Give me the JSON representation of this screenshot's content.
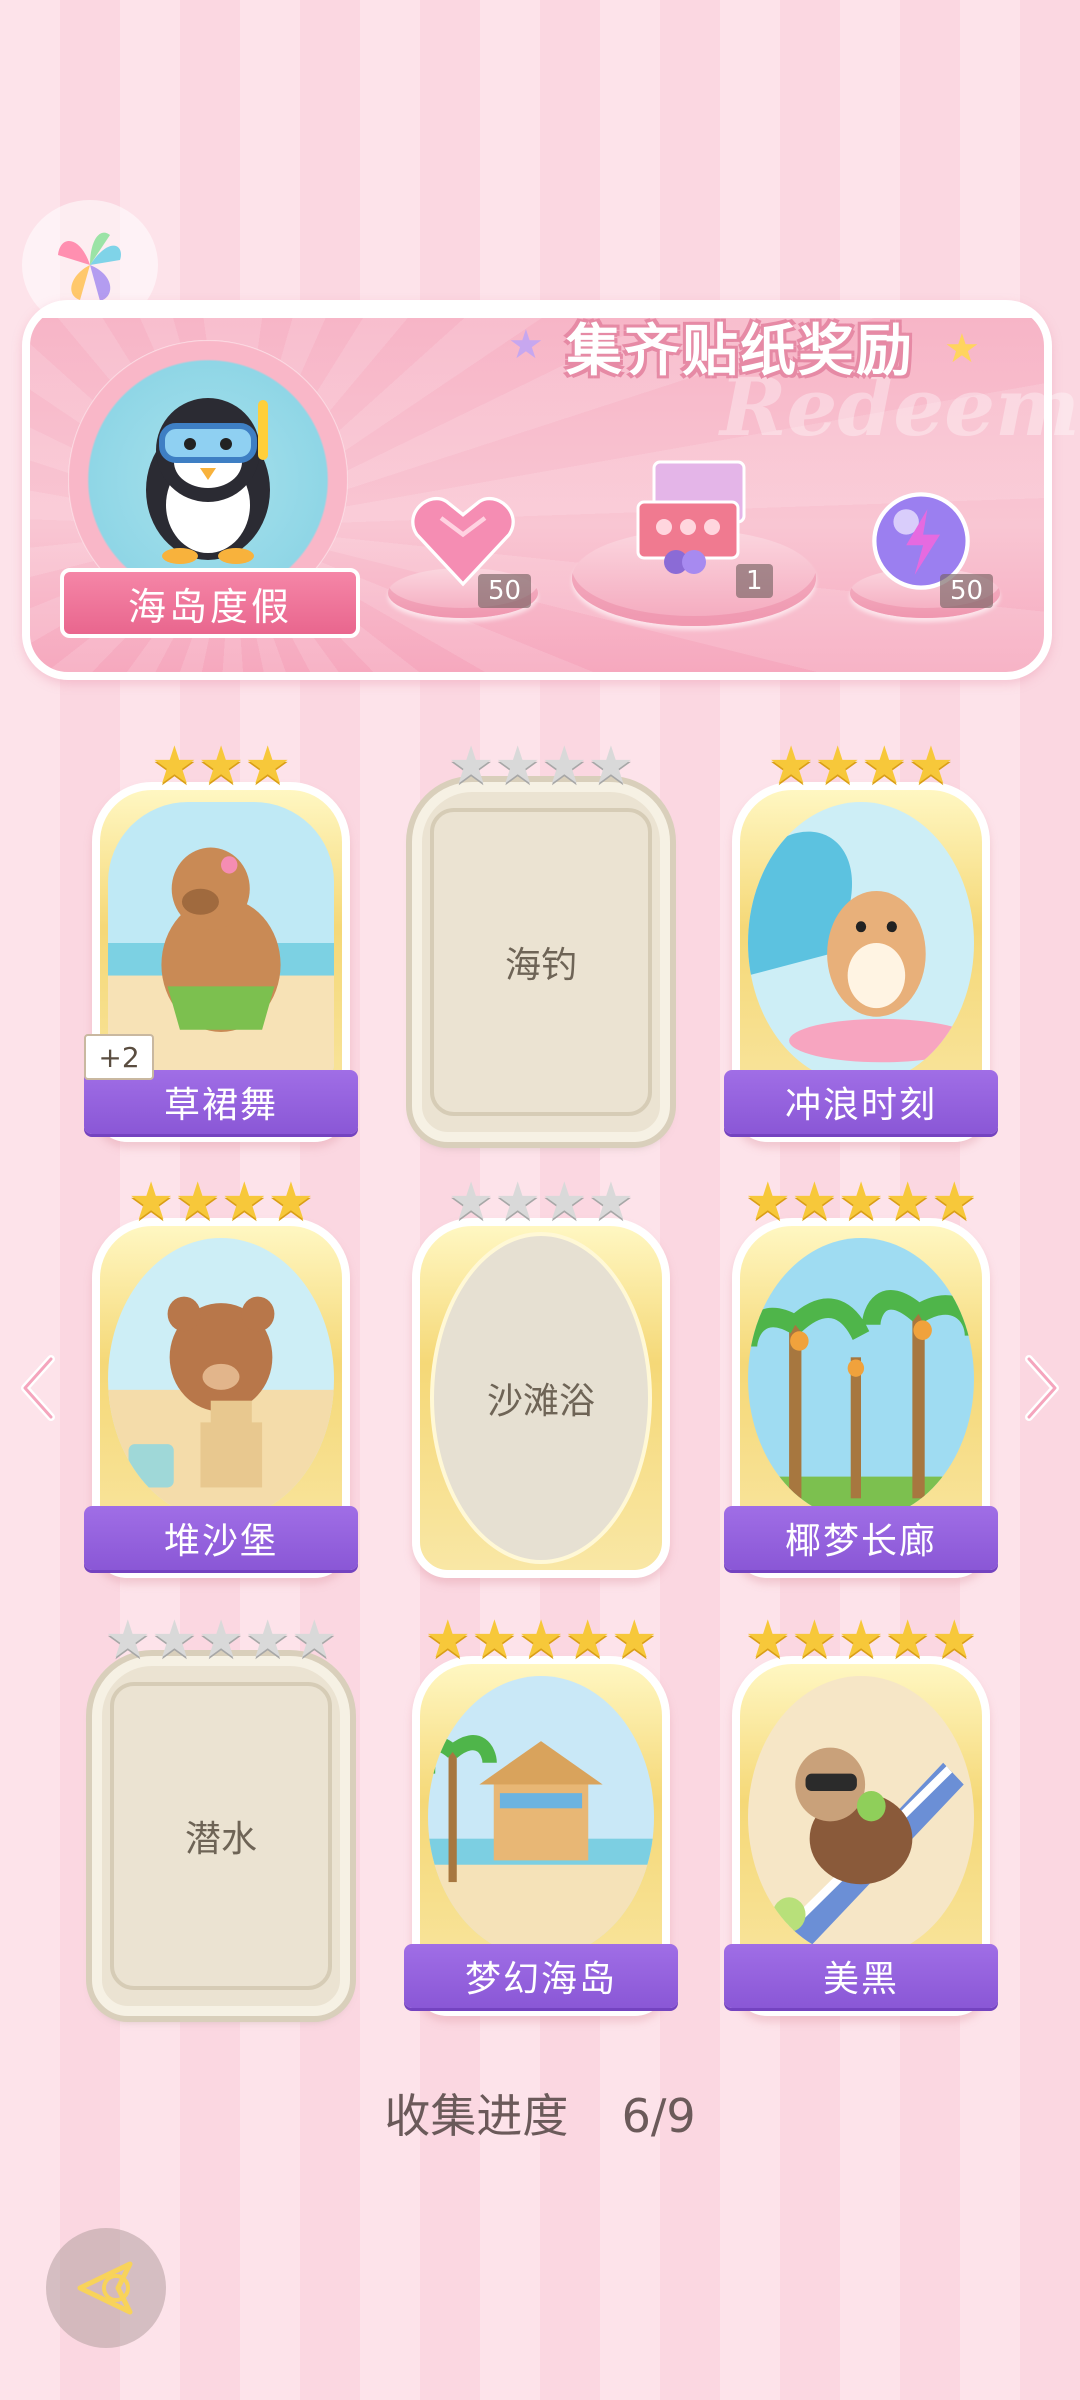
{
  "banner": {
    "title": "集齐贴纸奖励",
    "watermark": "Redeem",
    "album_name": "海岛度假",
    "rewards": [
      {
        "icon": "pink-heart-gem-icon",
        "qty": "50"
      },
      {
        "icon": "gift-box-icon",
        "qty": "1"
      },
      {
        "icon": "lightning-orb-icon",
        "qty": "50"
      }
    ]
  },
  "cards": [
    {
      "name": "草裙舞",
      "stars": 3,
      "max_stars": 3,
      "collected": true,
      "extra": "+2",
      "art": "capybara-hula-art"
    },
    {
      "name": "海钓",
      "stars": 0,
      "max_stars": 4,
      "collected": false,
      "art": ""
    },
    {
      "name": "冲浪时刻",
      "stars": 4,
      "max_stars": 4,
      "collected": true,
      "art": "hamster-surfing-art"
    },
    {
      "name": "堆沙堡",
      "stars": 4,
      "max_stars": 4,
      "collected": true,
      "art": "bear-sandcastle-art"
    },
    {
      "name": "沙滩浴",
      "stars": 0,
      "max_stars": 4,
      "collected": false,
      "art": ""
    },
    {
      "name": "椰梦长廊",
      "stars": 5,
      "max_stars": 5,
      "collected": true,
      "art": "coconut-palms-art"
    },
    {
      "name": "潜水",
      "stars": 0,
      "max_stars": 5,
      "collected": false,
      "art": ""
    },
    {
      "name": "梦幻海岛",
      "stars": 5,
      "max_stars": 5,
      "collected": true,
      "art": "beach-hut-art"
    },
    {
      "name": "美黑",
      "stars": 5,
      "max_stars": 5,
      "collected": true,
      "art": "cat-sunbathing-art"
    }
  ],
  "progress": {
    "label": "收集进度",
    "value": "6/9"
  },
  "colors": {
    "accent": "#8a57d6",
    "pink": "#f586a7",
    "gold": "#f7c83a"
  }
}
